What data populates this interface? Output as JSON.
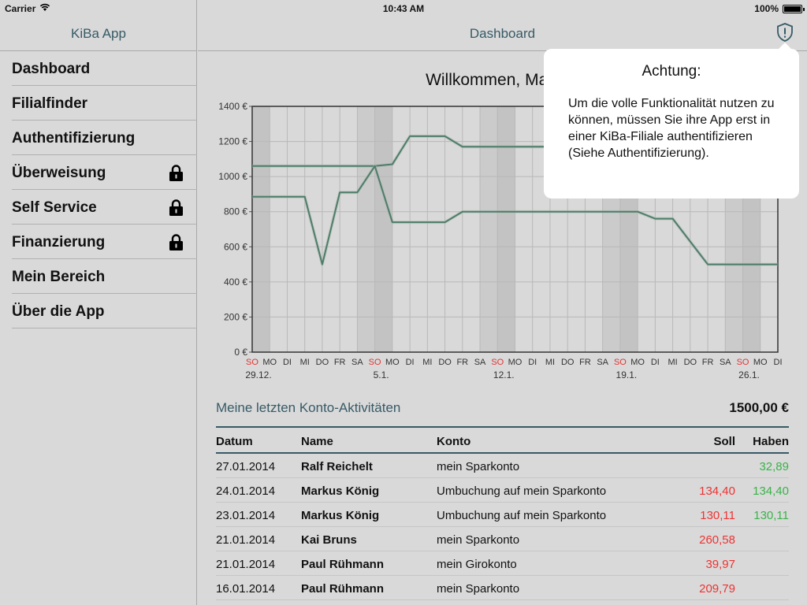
{
  "status_bar": {
    "carrier": "Carrier",
    "time": "10:43 AM",
    "battery": "100%"
  },
  "sidebar": {
    "title": "KiBa App",
    "items": [
      {
        "label": "Dashboard",
        "locked": false
      },
      {
        "label": "Filialfinder",
        "locked": false
      },
      {
        "label": "Authentifizierung",
        "locked": false
      },
      {
        "label": "Überweisung",
        "locked": true
      },
      {
        "label": "Self Service",
        "locked": true
      },
      {
        "label": "Finanzierung",
        "locked": true
      },
      {
        "label": "Mein Bereich",
        "locked": false
      },
      {
        "label": "Über die App",
        "locked": false
      }
    ]
  },
  "header": {
    "title": "Dashboard",
    "alert_icon": "shield-alert-icon"
  },
  "chart_title": "Willkommen, Markus",
  "chart_data": {
    "type": "line",
    "ylim": [
      0,
      1400
    ],
    "y_ticks": [
      "0 €",
      "200 €",
      "400 €",
      "600 €",
      "800 €",
      "1000 €",
      "1200 €",
      "1400 €"
    ],
    "x_day_labels": [
      "SO",
      "MO",
      "DI",
      "MI",
      "DO",
      "FR",
      "SA",
      "SO",
      "MO",
      "DI",
      "MI",
      "DO",
      "FR",
      "SA",
      "SO",
      "MO",
      "DI",
      "MI",
      "DO",
      "FR",
      "SA",
      "SO",
      "MO",
      "DI",
      "MI",
      "DO",
      "FR",
      "SA",
      "SO",
      "MO",
      "DI"
    ],
    "x_date_labels": [
      {
        "index": 0,
        "label": "29.12."
      },
      {
        "index": 7,
        "label": "5.1."
      },
      {
        "index": 14,
        "label": "12.1."
      },
      {
        "index": 21,
        "label": "19.1."
      },
      {
        "index": 28,
        "label": "26.1."
      }
    ],
    "sunday_indices": [
      0,
      7,
      14,
      21,
      28
    ],
    "series": [
      {
        "values": [
          1060,
          1060,
          1060,
          1060,
          1060,
          1060,
          1060,
          1060,
          1070,
          1230,
          1230,
          1230,
          1170,
          1170,
          1170,
          1170,
          1170,
          1170,
          1170,
          1170,
          1170,
          1170,
          1170,
          1170,
          1170,
          1170,
          1170,
          1170,
          1170,
          1170,
          1170
        ]
      },
      {
        "values": [
          885,
          885,
          885,
          885,
          500,
          910,
          910,
          1060,
          740,
          740,
          740,
          740,
          800,
          800,
          800,
          800,
          800,
          800,
          800,
          800,
          800,
          800,
          800,
          760,
          760,
          630,
          500,
          500,
          500,
          500,
          500
        ]
      }
    ],
    "line_color": "#4e7d69",
    "sunday_color": "#e33333"
  },
  "activities": {
    "title": "Meine letzten Konto-Aktivitäten",
    "total": "1500,00 €",
    "columns": [
      "Datum",
      "Name",
      "Konto",
      "Soll",
      "Haben"
    ],
    "rows": [
      {
        "date": "27.01.2014",
        "name": "Ralf Reichelt",
        "konto": "mein Sparkonto",
        "soll": "",
        "haben": "32,89"
      },
      {
        "date": "24.01.2014",
        "name": "Markus König",
        "konto": "Umbuchung auf mein Sparkonto",
        "soll": "134,40",
        "haben": "134,40"
      },
      {
        "date": "23.01.2014",
        "name": "Markus König",
        "konto": "Umbuchung auf mein Sparkonto",
        "soll": "130,11",
        "haben": "130,11"
      },
      {
        "date": "21.01.2014",
        "name": "Kai Bruns",
        "konto": "mein Sparkonto",
        "soll": "260,58",
        "haben": ""
      },
      {
        "date": "21.01.2014",
        "name": "Paul Rühmann",
        "konto": "mein Girokonto",
        "soll": "39,97",
        "haben": ""
      },
      {
        "date": "16.01.2014",
        "name": "Paul Rühmann",
        "konto": "mein Sparkonto",
        "soll": "209,79",
        "haben": ""
      }
    ]
  },
  "popover": {
    "title": "Achtung:",
    "text": "Um die volle Funktionalität nutzen zu können, müssen Sie ihre App erst in einer KiBa-Filiale authentifizieren (Siehe Authentifizierung)."
  },
  "colors": {
    "accent": "#375a66",
    "debit": "#e33333",
    "credit": "#3ab34a"
  }
}
